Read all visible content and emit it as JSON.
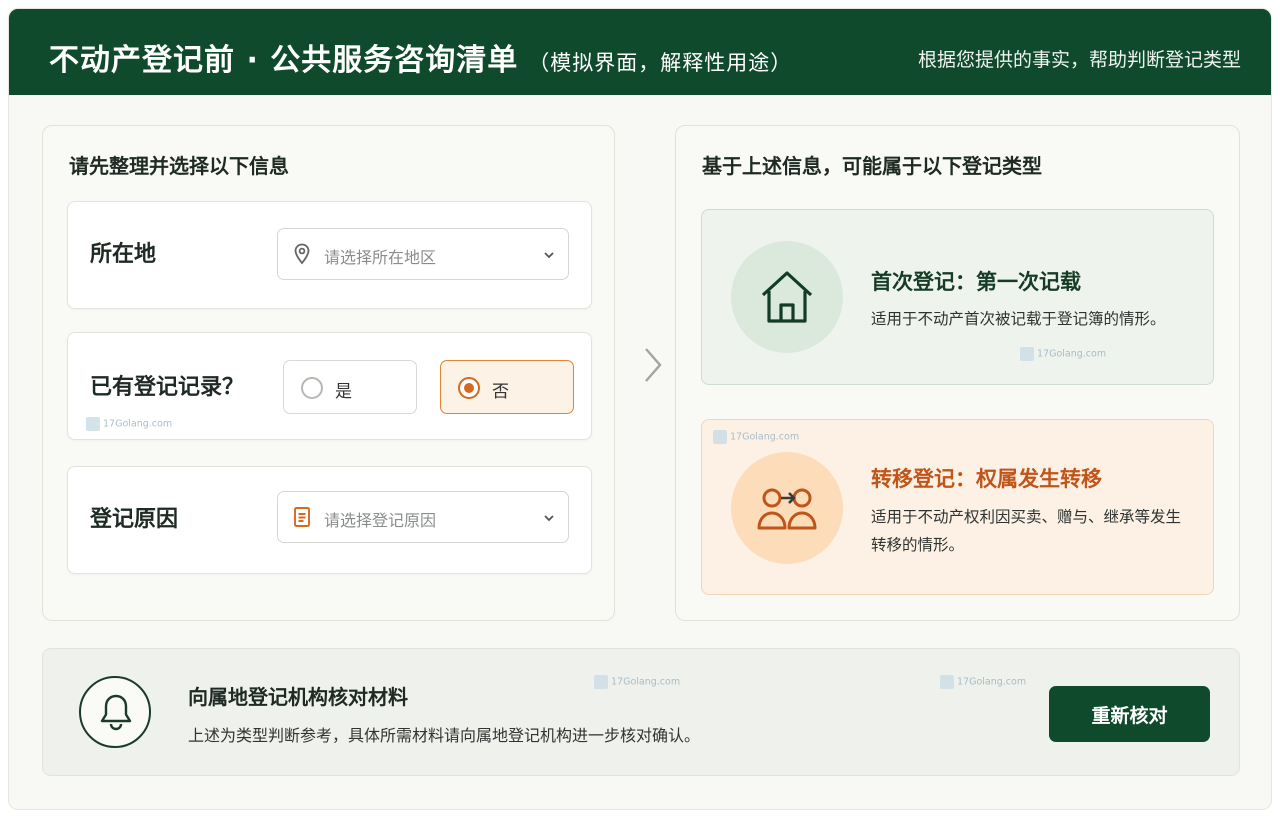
{
  "header": {
    "title": "不动产登记前 · 公共服务咨询清单",
    "subtitle": "（模拟界面，解释性用途）",
    "tagline": "根据您提供的事实，帮助判断登记类型"
  },
  "left_panel": {
    "title": "请先整理并选择以下信息",
    "location": {
      "label": "所在地",
      "placeholder": "请选择所在地区",
      "icon": "location-pin-icon"
    },
    "record": {
      "label": "已有登记记录？",
      "options": [
        {
          "label": "是",
          "selected": false
        },
        {
          "label": "否",
          "selected": true
        }
      ]
    },
    "reason": {
      "label": "登记原因",
      "placeholder": "请选择登记原因",
      "icon": "document-icon"
    }
  },
  "right_panel": {
    "title": "基于上述信息，可能属于以下登记类型",
    "types": [
      {
        "title": "首次登记：第一次记载",
        "desc": "适用于不动产首次被记载于登记簿的情形。",
        "icon": "house-icon",
        "color": "#153c25"
      },
      {
        "title": "转移登记：权属发生转移",
        "desc": "适用于不动产权利因买卖、赠与、继承等发生转移的情形。",
        "icon": "person-transfer-icon",
        "color": "#c0551a"
      }
    ]
  },
  "bottom": {
    "title": "向属地登记机构核对材料",
    "desc": "上述为类型判断参考，具体所需材料请向属地登记机构进一步核对确认。",
    "button": "重新核对",
    "icon": "bell-icon"
  },
  "watermark": "17Golang.com",
  "colors": {
    "brand": "#0f4a2c",
    "accent": "#d4691f",
    "bg": "#f8f8f4"
  }
}
